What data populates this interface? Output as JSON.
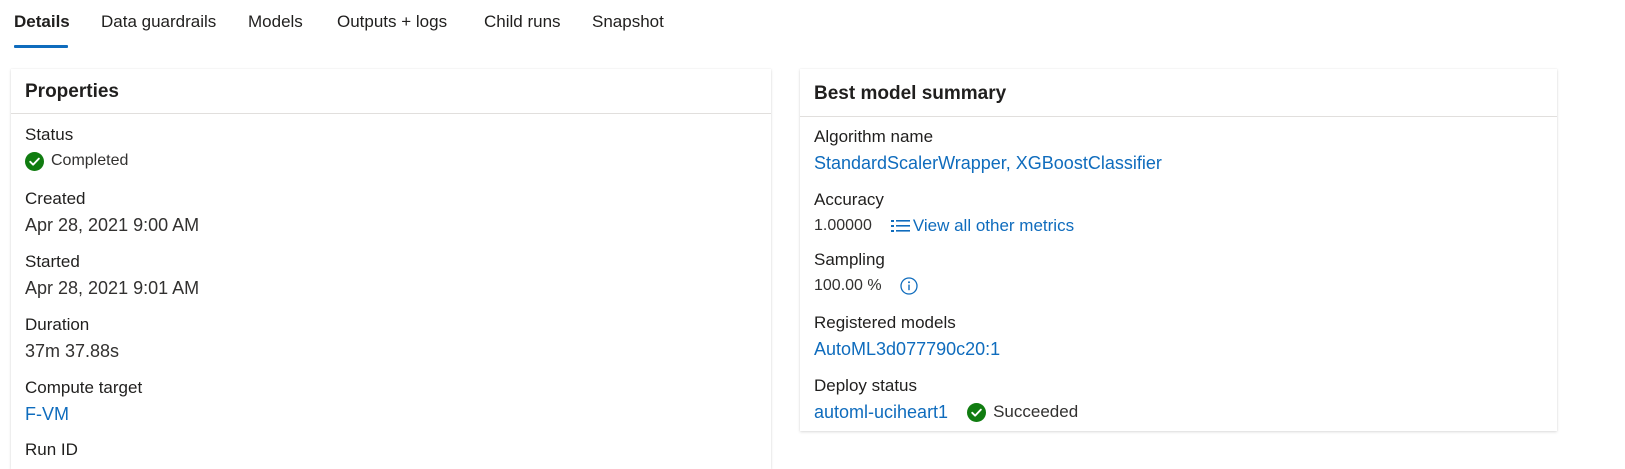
{
  "tabs": [
    {
      "label": "Details",
      "active": true
    },
    {
      "label": "Data guardrails",
      "active": false
    },
    {
      "label": "Models",
      "active": false
    },
    {
      "label": "Outputs + logs",
      "active": false
    },
    {
      "label": "Child runs",
      "active": false
    },
    {
      "label": "Snapshot",
      "active": false
    }
  ],
  "properties": {
    "title": "Properties",
    "status_label": "Status",
    "status_value": "Completed",
    "created_label": "Created",
    "created_value": "Apr 28, 2021 9:00 AM",
    "started_label": "Started",
    "started_value": "Apr 28, 2021 9:01 AM",
    "duration_label": "Duration",
    "duration_value": "37m 37.88s",
    "compute_label": "Compute target",
    "compute_value": "F-VM",
    "runid_label": "Run ID"
  },
  "summary": {
    "title": "Best model summary",
    "algorithm_label": "Algorithm name",
    "algorithm_value": "StandardScalerWrapper, XGBoostClassifier",
    "accuracy_label": "Accuracy",
    "accuracy_value": "1.00000",
    "metrics_link": "View all other metrics",
    "sampling_label": "Sampling",
    "sampling_value": "100.00 %",
    "registered_label": "Registered models",
    "registered_value": "AutoML3d077790c20:1",
    "deploy_label": "Deploy status",
    "deploy_endpoint": "automl-uciheart1",
    "deploy_status": "Succeeded"
  },
  "icons": {
    "success": "check-circle-icon",
    "info": "info-icon",
    "metrics": "list-icon"
  },
  "colors": {
    "accent": "#0f6cbd",
    "success": "#107c10"
  }
}
